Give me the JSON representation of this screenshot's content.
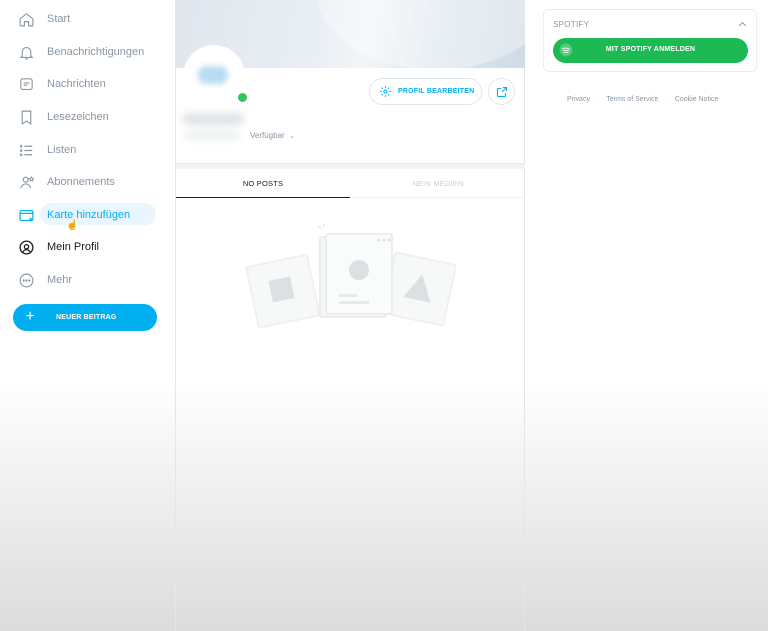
{
  "sidebar": {
    "items": [
      {
        "label": "Start",
        "icon": "home-icon"
      },
      {
        "label": "Benachrichtigungen",
        "icon": "bell-icon"
      },
      {
        "label": "Nachrichten",
        "icon": "message-icon"
      },
      {
        "label": "Lesezeichen",
        "icon": "bookmark-icon"
      },
      {
        "label": "Listen",
        "icon": "list-icon"
      },
      {
        "label": "Abonnements",
        "icon": "subscriptions-icon"
      },
      {
        "label": "Karte hinzufügen",
        "icon": "credit-card-icon"
      },
      {
        "label": "Mein Profil",
        "icon": "profile-icon"
      },
      {
        "label": "Mehr",
        "icon": "more-icon"
      }
    ],
    "new_post_label": "NEUER BEITRAG"
  },
  "profile": {
    "status": "Verfügbar",
    "edit_label": "PROFIL BEARBEITEN"
  },
  "tabs": [
    {
      "label": "NO POSTS"
    },
    {
      "label": "NEIN MEDIEN"
    }
  ],
  "spotify": {
    "title": "SPOTIFY",
    "connect_label": "MIT SPOTIFY ANMELDEN"
  },
  "footer": {
    "privacy": "Privacy",
    "terms": "Terms of Service",
    "cookie": "Cookie Notice"
  },
  "colors": {
    "accent": "#00aff0",
    "spotify_green": "#1db954",
    "online_green": "#35c35c",
    "muted_text": "#8a96a3"
  }
}
